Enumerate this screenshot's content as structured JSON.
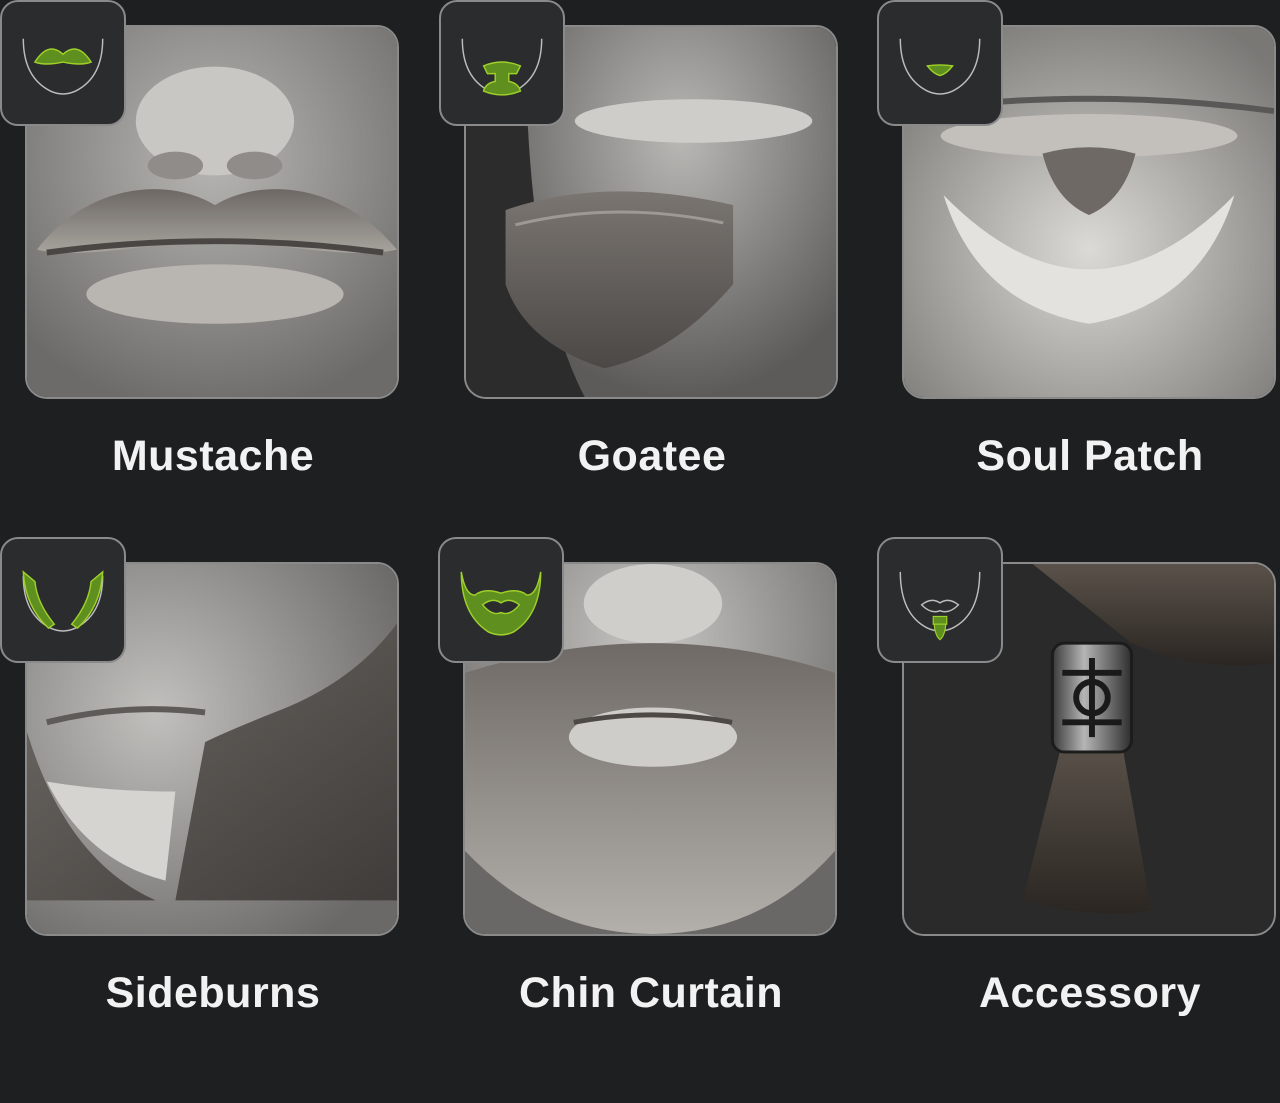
{
  "styles": [
    {
      "id": "mustache",
      "label": "Mustache",
      "icon": "mustache-outline-icon"
    },
    {
      "id": "goatee",
      "label": "Goatee",
      "icon": "goatee-outline-icon"
    },
    {
      "id": "soul-patch",
      "label": "Soul Patch",
      "icon": "soul-patch-outline-icon"
    },
    {
      "id": "sideburns",
      "label": "Sideburns",
      "icon": "sideburns-outline-icon"
    },
    {
      "id": "chin-curtain",
      "label": "Chin Curtain",
      "icon": "chin-curtain-outline-icon"
    },
    {
      "id": "accessory",
      "label": "Accessory",
      "icon": "beard-bead-outline-icon"
    }
  ],
  "colors": {
    "background": "#1e1f21",
    "accent_green": "#5f8f1e",
    "accent_green_stroke": "#9fd02a",
    "border": "#8a8a8a",
    "label": "#f2f2f2"
  }
}
